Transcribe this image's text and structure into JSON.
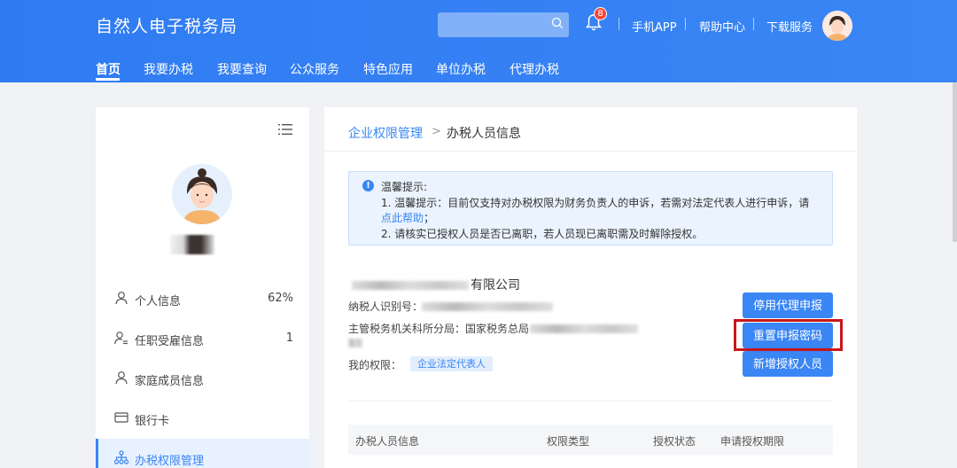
{
  "header": {
    "title": "自然人电子税务局",
    "notification_count": "8",
    "links": [
      "手机APP",
      "帮助中心",
      "下载服务"
    ]
  },
  "nav": {
    "items": [
      "首页",
      "我要办税",
      "我要查询",
      "公众服务",
      "特色应用",
      "单位办税",
      "代理办税"
    ],
    "active": "首页"
  },
  "sidebar": {
    "items": [
      {
        "label": "个人信息",
        "value": "62%",
        "icon": "user-icon"
      },
      {
        "label": "任职受雇信息",
        "value": "1",
        "icon": "user-list-icon"
      },
      {
        "label": "家庭成员信息",
        "value": "",
        "icon": "family-icon"
      },
      {
        "label": "银行卡",
        "value": "",
        "icon": "bank-card-icon"
      },
      {
        "label": "办税权限管理",
        "value": "",
        "icon": "org-chart-icon",
        "active": true
      }
    ]
  },
  "breadcrumb": {
    "parent": "企业权限管理",
    "separator": ">",
    "current": "办税人员信息"
  },
  "notice": {
    "icon": "!",
    "title": "温馨提示:",
    "line1": "1. 温馨提示：目前仅支持对办税权限为财务负责人的申诉，若需对法定代表人进行申诉，请",
    "link": "点此帮助",
    "link_suffix": "；",
    "line2": "2. 请核实已授权人员是否已离职，若人员现已离职需及时解除授权。"
  },
  "company": {
    "name_suffix": "有限公司",
    "tax_id_label": "纳税人识别号：",
    "tax_office_label": "主管税务机关科所分局：",
    "tax_office_prefix": "国家税务总局",
    "permission_label": "我的权限：",
    "permission_tag": "企业法定代表人"
  },
  "actions": {
    "stop_agent": "停用代理申报",
    "reset_password": "重置申报密码",
    "add_authorized": "新增授权人员"
  },
  "table": {
    "headers": [
      "办税人员信息",
      "权限类型",
      "授权状态",
      "申请授权期限"
    ]
  },
  "colors": {
    "primary": "#3a86f5",
    "highlight_border": "#c7161c",
    "badge": "#f5483b"
  }
}
